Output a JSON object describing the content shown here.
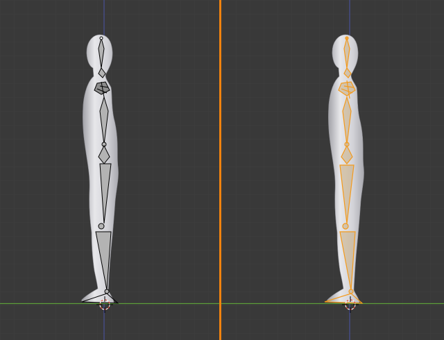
{
  "viewport": {
    "title": "",
    "background_color": "#393939",
    "grid_minor_color": "#3f3f3f",
    "grid_major_color": "#474747",
    "ground_axis_color": "#5c9e3a",
    "vertical_axis_color": "#4a55a8",
    "split_line_color": "#f0820e",
    "cursor_color": "#e24a3c"
  },
  "mesh": {
    "body_color": "#d6d6da",
    "body_shadow_color": "#a7a7ad"
  },
  "armature_left": {
    "state": "unselected",
    "bone_fill": "#b3b3b3",
    "bone_outline": "#000000"
  },
  "armature_right": {
    "state": "selected",
    "bone_fill": "#c28e48",
    "bone_outline": "#f39a1c"
  },
  "icons": {
    "cursor": "3d-cursor-icon",
    "split": "viewport-split"
  }
}
